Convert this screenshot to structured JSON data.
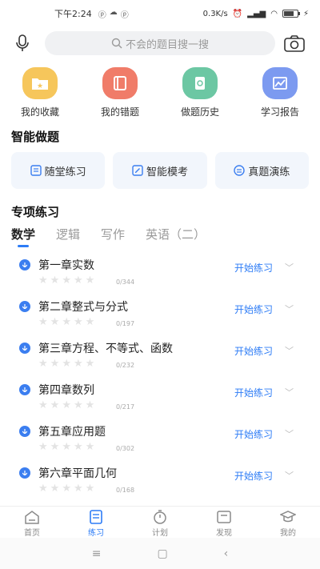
{
  "status": {
    "time": "下午2:24",
    "network_speed": "0.3K/s",
    "battery_level": 0.7
  },
  "search": {
    "placeholder": "不会的题目搜一搜"
  },
  "quick_actions": [
    {
      "label": "我的收藏",
      "icon": "folder-star-icon",
      "color": "#f6c65b"
    },
    {
      "label": "我的错题",
      "icon": "wrong-book-icon",
      "color": "#f07c69"
    },
    {
      "label": "做题历史",
      "icon": "history-doc-icon",
      "color": "#6cc7a3"
    },
    {
      "label": "学习报告",
      "icon": "report-chart-icon",
      "color": "#7c9af0"
    }
  ],
  "smart_section": {
    "title": "智能做题",
    "cards": [
      {
        "label": "随堂练习",
        "icon": "practice-icon"
      },
      {
        "label": "智能模考",
        "icon": "mock-exam-icon"
      },
      {
        "label": "真题演练",
        "icon": "real-exam-icon"
      }
    ]
  },
  "special_section": {
    "title": "专项练习",
    "tabs": [
      "数学",
      "逻辑",
      "写作",
      "英语（二）"
    ],
    "active_tab": 0
  },
  "chapters": [
    {
      "title": "第一章实数",
      "count": "0/344",
      "action": "开始练习",
      "stars": 0
    },
    {
      "title": "第二章整式与分式",
      "count": "0/197",
      "action": "开始练习",
      "stars": 0
    },
    {
      "title": "第三章方程、不等式、函数",
      "count": "0/232",
      "action": "开始练习",
      "stars": 0
    },
    {
      "title": "第四章数列",
      "count": "0/217",
      "action": "开始练习",
      "stars": 0
    },
    {
      "title": "第五章应用题",
      "count": "0/302",
      "action": "开始练习",
      "stars": 0
    },
    {
      "title": "第六章平面几何",
      "count": "0/168",
      "action": "开始练习",
      "stars": 0
    }
  ],
  "bottom_nav": [
    {
      "label": "首页",
      "icon": "home-icon"
    },
    {
      "label": "练习",
      "icon": "practice-book-icon"
    },
    {
      "label": "计划",
      "icon": "timer-icon"
    },
    {
      "label": "发现",
      "icon": "discover-icon"
    },
    {
      "label": "我的",
      "icon": "graduate-cap-icon"
    }
  ],
  "active_nav": 1,
  "colors": {
    "accent": "#2d7cf6",
    "star_empty": "#e3e3e3"
  }
}
